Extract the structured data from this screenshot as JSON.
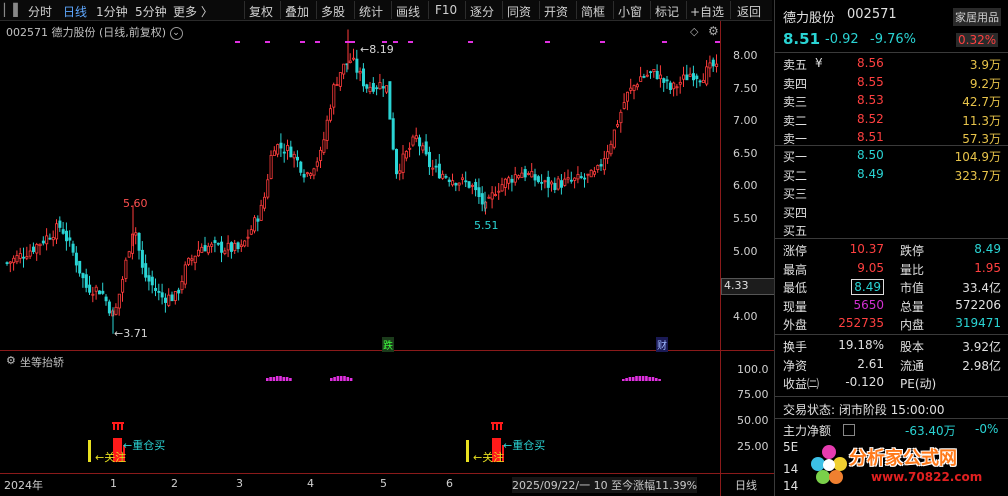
{
  "toolbar": {
    "items": [
      "分时",
      "日线",
      "1分钟",
      "5分钟",
      "更多 〉",
      "复权",
      "叠加",
      "多股",
      "统计",
      "画线",
      "F10",
      "逐分",
      "同资",
      "开资",
      "简框",
      "小窗",
      "标记",
      "+自选",
      "返回"
    ]
  },
  "chart_header": {
    "code": "002571",
    "title": "德力股份 (日线,前复权)"
  },
  "price_axis": [
    "8.00",
    "7.50",
    "7.00",
    "6.50",
    "6.00",
    "5.50",
    "5.00",
    "4.50",
    "4.00"
  ],
  "last_price_tag": "4.33",
  "annotations": {
    "high_overall": "8.19",
    "high_early": "5.60",
    "low_mid": "5.51",
    "low_overall": "3.71",
    "event_die": "跌",
    "event_cai": "财"
  },
  "indicator": {
    "name": "坐等抬轿",
    "axis": [
      "100.0",
      "75.00",
      "50.00",
      "25.00"
    ],
    "label_heavy": "重仓买",
    "label_watch": "关注"
  },
  "x_axis": {
    "labels": [
      "2024年",
      "1",
      "2",
      "3",
      "4",
      "5",
      "6"
    ],
    "status": "2025/09/22/一 10 至今涨幅11.39%",
    "period": "日线"
  },
  "chart_data": {
    "type": "candlestick",
    "annotated_prices": {
      "high": 8.19,
      "low": 3.71,
      "local_high": 5.6,
      "local_low": 5.51
    },
    "ylim": [
      3.5,
      8.3
    ]
  },
  "panel": {
    "name": "德力股份",
    "code": "002571",
    "tag": "家居用品",
    "price": "8.51",
    "change": "-0.92",
    "change_pct": "-9.76%",
    "turnover_pct": "0.32%",
    "asks": [
      {
        "label": "卖五",
        "mark": "¥",
        "price": "8.56",
        "vol": "3.9万"
      },
      {
        "label": "卖四",
        "mark": "",
        "price": "8.55",
        "vol": "9.2万"
      },
      {
        "label": "卖三",
        "mark": "",
        "price": "8.53",
        "vol": "42.7万"
      },
      {
        "label": "卖二",
        "mark": "",
        "price": "8.52",
        "vol": "11.3万"
      },
      {
        "label": "卖一",
        "mark": "",
        "price": "8.51",
        "vol": "57.3万"
      }
    ],
    "bids": [
      {
        "label": "买一",
        "price": "8.50",
        "vol": "104.9万"
      },
      {
        "label": "买二",
        "price": "8.49",
        "vol": "323.7万"
      },
      {
        "label": "买三",
        "price": "",
        "vol": ""
      },
      {
        "label": "买四",
        "price": "",
        "vol": ""
      },
      {
        "label": "买五",
        "price": "",
        "vol": ""
      }
    ],
    "stats": [
      {
        "l1": "涨停",
        "v1": "10.37",
        "l2": "跌停",
        "v2": "8.49"
      },
      {
        "l1": "最高",
        "v1": "9.05",
        "l2": "量比",
        "v2": "1.95"
      },
      {
        "l1": "最低",
        "v1": "8.49",
        "l2": "市值",
        "v2": "33.4亿"
      },
      {
        "l1": "现量",
        "v1": "5650",
        "l2": "总量",
        "v2": "572206"
      },
      {
        "l1": "外盘",
        "v1": "252735",
        "l2": "内盘",
        "v2": "319471"
      }
    ],
    "stats2": [
      {
        "l1": "换手",
        "v1": "19.18%",
        "l2": "股本",
        "v2": "3.92亿"
      },
      {
        "l1": "净资",
        "v1": "2.61",
        "l2": "流通",
        "v2": "2.98亿"
      },
      {
        "l1": "收益㈡",
        "v1": "-0.120",
        "l2": "PE(动)",
        "v2": ""
      }
    ],
    "trade_state": "交易状态: 闭市阶段 15:00:00",
    "main_net_label": "主力净额",
    "main_net_value": "-63.40万",
    "main_net_pct": "-0%",
    "row_5e": "5E",
    "row_14a": "14",
    "row_14b": "14",
    "watermark_text": "分析家公式网",
    "watermark_url": "www.70822.com"
  }
}
